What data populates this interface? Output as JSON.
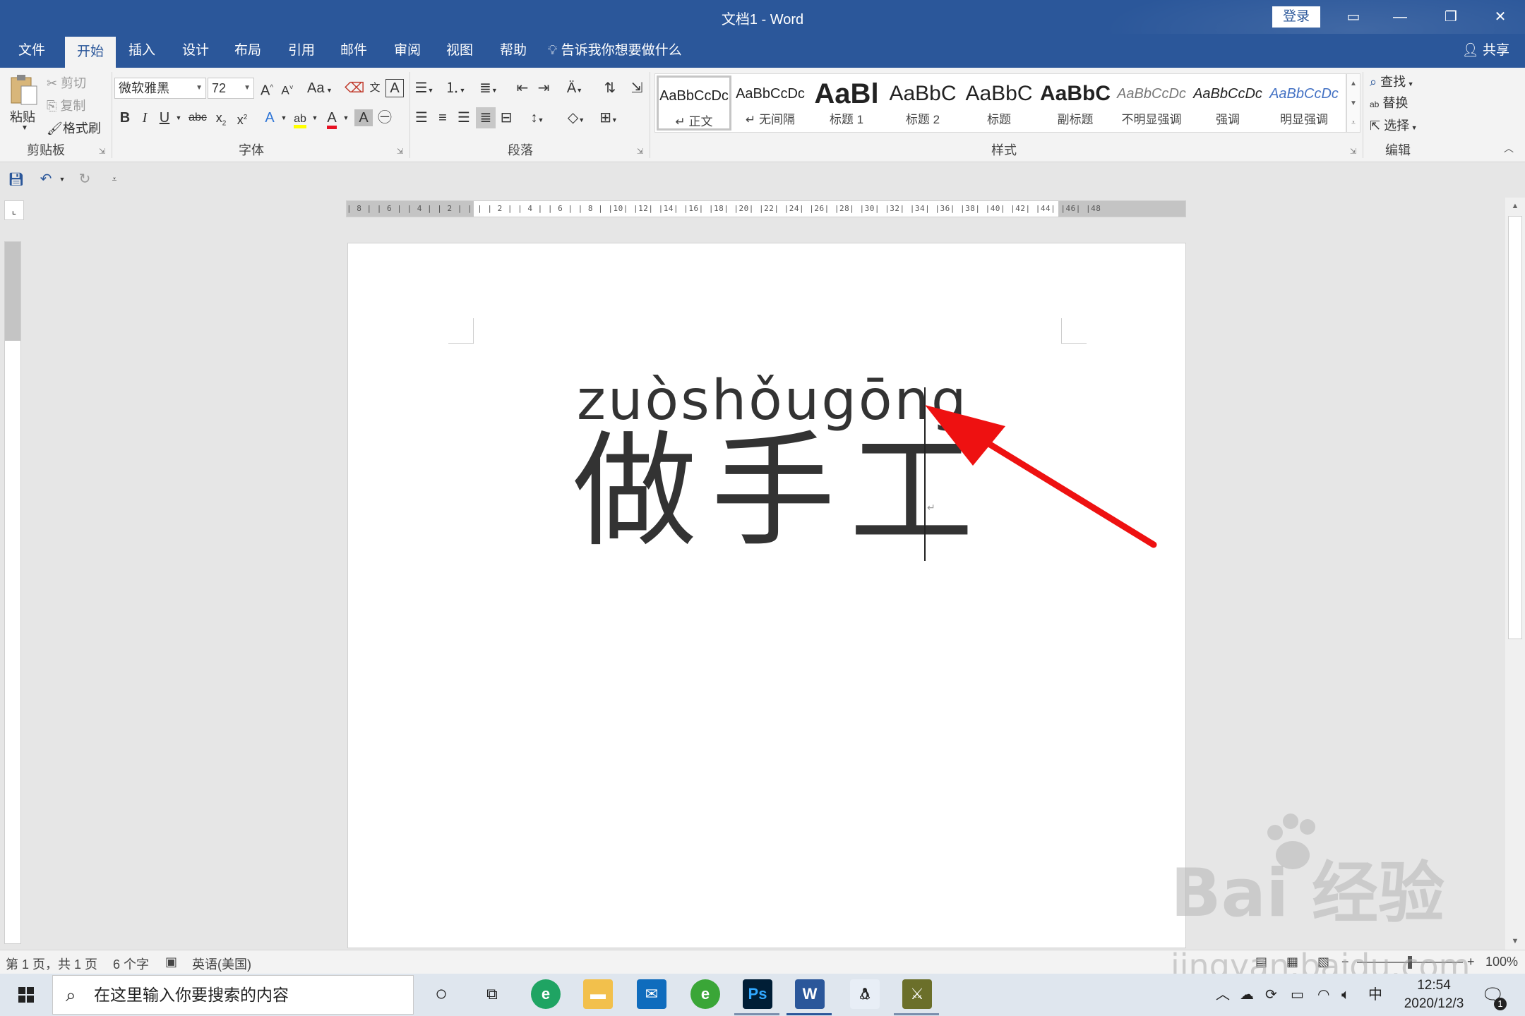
{
  "titlebar": {
    "title": "文档1  -  Word",
    "login": "登录"
  },
  "menu": {
    "tabs": [
      {
        "label": "文件"
      },
      {
        "label": "开始"
      },
      {
        "label": "插入"
      },
      {
        "label": "设计"
      },
      {
        "label": "布局"
      },
      {
        "label": "引用"
      },
      {
        "label": "邮件"
      },
      {
        "label": "审阅"
      },
      {
        "label": "视图"
      },
      {
        "label": "帮助"
      }
    ],
    "active_tab": "开始",
    "tell_me": "告诉我你想要做什么",
    "share": "共享"
  },
  "ribbon": {
    "clipboard": {
      "paste": "粘贴",
      "cut": "剪切",
      "copy": "复制",
      "format_painter": "格式刷",
      "label": "剪贴板"
    },
    "font": {
      "font_name": "微软雅黑",
      "font_size": "72",
      "change_case": "Aa",
      "label": "字体"
    },
    "paragraph": {
      "label": "段落"
    },
    "styles": {
      "items": [
        {
          "preview": "AaBbCcDc",
          "label": "↵ 正文"
        },
        {
          "preview": "AaBbCcDc",
          "label": "↵ 无间隔"
        },
        {
          "preview": "AaBl",
          "label": "标题 1"
        },
        {
          "preview": "AaBbC",
          "label": "标题 2"
        },
        {
          "preview": "AaBbC",
          "label": "标题"
        },
        {
          "preview": "AaBbC",
          "label": "副标题"
        },
        {
          "preview": "AaBbCcDc",
          "label": "不明显强调"
        },
        {
          "preview": "AaBbCcDc",
          "label": "强调"
        },
        {
          "preview": "AaBbCcDc",
          "label": "明显强调"
        }
      ],
      "label": "样式"
    },
    "editing": {
      "find": "查找",
      "replace": "替换",
      "select": "选择",
      "label": "编辑"
    }
  },
  "ruler": {
    "h_numbers": "| 8 |   | 6 |   | 4 |   | 2 |   |   |   | 2 |   | 4 |   | 6 |   | 8 |   |10|   |12|   |14|   |16|   |18|   |20|   |22|   |24|   |26|   |28|   |30|   |32|   |34|   |36|   |38|   |40|   |42|   |44|   |46|   |48"
  },
  "document": {
    "pinyin": "zuòshǒugōng",
    "characters": "做手工"
  },
  "statusbar": {
    "page": "第 1 页，共 1 页",
    "words": "6 个字",
    "language": "英语(美国)",
    "zoom": "100%"
  },
  "taskbar": {
    "search_placeholder": "在这里输入你要搜索的内容",
    "ime": "中",
    "time": "12:54",
    "date": "2020/12/3",
    "notification_count": "1"
  },
  "watermark": {
    "main": "Bai 经验",
    "sub": "jingyan.baidu.com"
  },
  "colors": {
    "word_blue": "#2b579a",
    "arrow_red": "#ee1111"
  }
}
